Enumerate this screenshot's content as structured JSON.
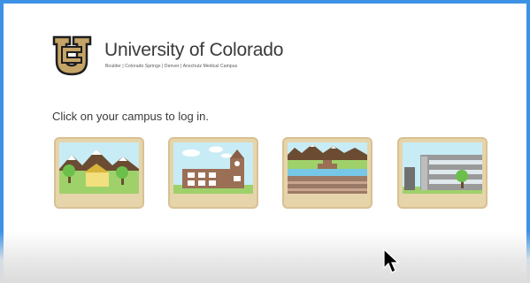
{
  "brand": {
    "name": "University of Colorado",
    "campuses_line": "Boulder | Colorado Springs | Denver | Anschutz Medical Campus",
    "logo_icon": "cu-logo-icon"
  },
  "prompt": "Click on your campus to log in.",
  "campus_tiles": [
    {
      "name": "campus-tile-boulder",
      "icon": "mountain-campus-icon"
    },
    {
      "name": "campus-tile-colorado-springs",
      "icon": "clocktower-campus-icon"
    },
    {
      "name": "campus-tile-denver",
      "icon": "river-campus-icon"
    },
    {
      "name": "campus-tile-anschutz",
      "icon": "medical-building-campus-icon"
    }
  ],
  "colors": {
    "window_border": "#3d92e6",
    "tile_frame": "#e6d4aa",
    "logo_gold": "#c4a467",
    "text": "#3a3a3a"
  }
}
